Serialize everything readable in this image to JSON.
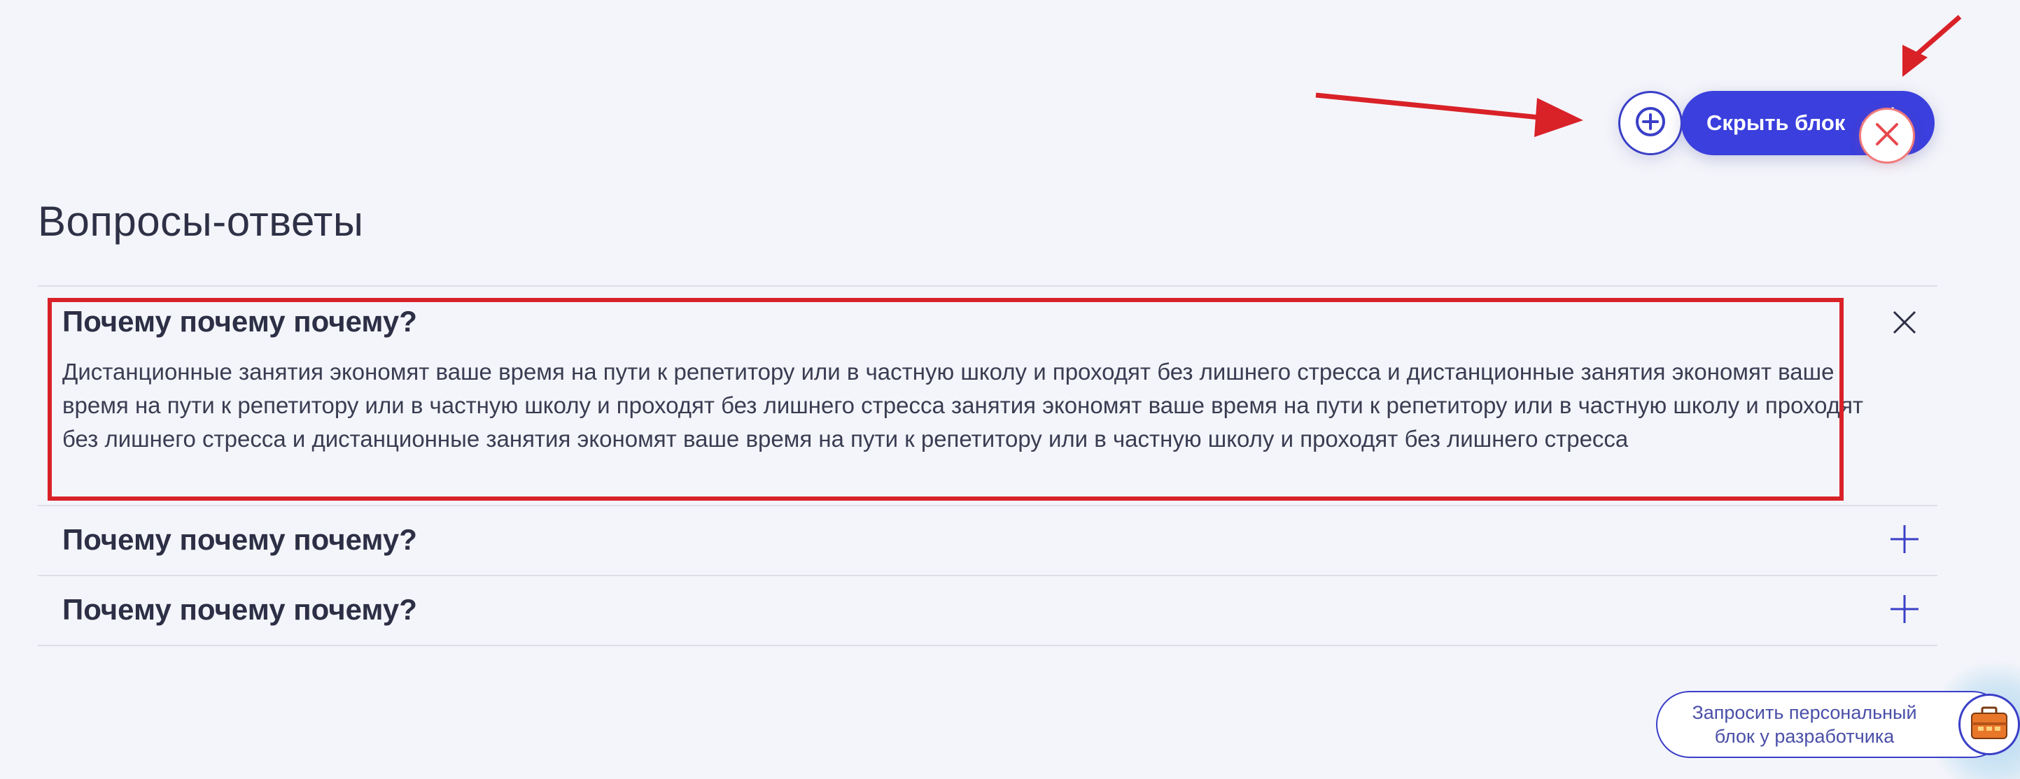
{
  "header": {
    "add_block_icon": "plus-circle-icon",
    "hide_block_label": "Скрыть блок",
    "hide_block_icon": "eye-off-icon"
  },
  "section": {
    "title": "Вопросы-ответы"
  },
  "faq": {
    "items": [
      {
        "question": "Почему почему почему?",
        "answer": "Дистанционные занятия экономят ваше время на пути к репетитору или в частную школу и проходят без лишнего стресса и дистанционные занятия экономят ваше время на пути к репетитору или в частную школу и проходят без лишнего стресса занятия экономят ваше время на пути к репетитору или в частную школу и проходят без лишнего стресса и дистанционные занятия экономят ваше время на пути к репетитору или в частную школу и проходят без лишнего стресса",
        "expanded": true,
        "toggle_icon": "close-icon"
      },
      {
        "question": "Почему почему почему?",
        "expanded": false,
        "toggle_icon": "plus-icon"
      },
      {
        "question": "Почему почему почему?",
        "expanded": false,
        "toggle_icon": "plus-icon"
      }
    ],
    "delete_icon": "delete-circle-icon"
  },
  "request_widget": {
    "line1": "Запросить персональный",
    "line2": "блок у разработчика",
    "icon": "developer-toolbox-icon"
  },
  "colors": {
    "accent": "#3a3fdd",
    "annotation_red": "#d92128",
    "background": "#f4f5fa"
  }
}
